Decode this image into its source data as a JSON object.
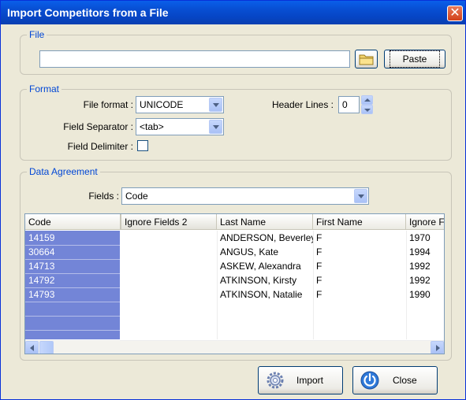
{
  "window": {
    "title": "Import Competitors from a File",
    "close_glyph": "✕"
  },
  "file": {
    "legend": "File",
    "path_value": "",
    "browse_icon": "folder-icon",
    "paste_label": "Paste"
  },
  "format": {
    "legend": "Format",
    "file_format_label": "File format :",
    "file_format_value": "UNICODE",
    "header_lines_label": "Header Lines :",
    "header_lines_value": "0",
    "field_separator_label": "Field Separator :",
    "field_separator_value": "<tab>",
    "field_delimiter_label": "Field Delimiter :",
    "field_delimiter_checked": false
  },
  "data_agreement": {
    "legend": "Data Agreement",
    "fields_label": "Fields :",
    "fields_value": "Code",
    "columns": [
      "Code",
      "Ignore Fields 2",
      "Last Name",
      "First Name",
      "Ignore F"
    ],
    "rows": [
      [
        "14159",
        "",
        "ANDERSON, Beverley",
        "F",
        "1970"
      ],
      [
        "30664",
        "",
        "ANGUS, Kate",
        "F",
        "1994"
      ],
      [
        "14713",
        "",
        "ASKEW, Alexandra",
        "F",
        "1992"
      ],
      [
        "14792",
        "",
        "ATKINSON, Kirsty",
        "F",
        "1992"
      ],
      [
        "14793",
        "",
        "ATKINSON, Natalie",
        "F",
        "1990"
      ]
    ]
  },
  "actions": {
    "import_label": "Import",
    "close_label": "Close",
    "import_icon": "gear-icon",
    "close_icon": "power-icon"
  },
  "colors": {
    "titlebar": "#0A5FEA",
    "selection": "#7385D7",
    "legend": "#0046D5"
  }
}
